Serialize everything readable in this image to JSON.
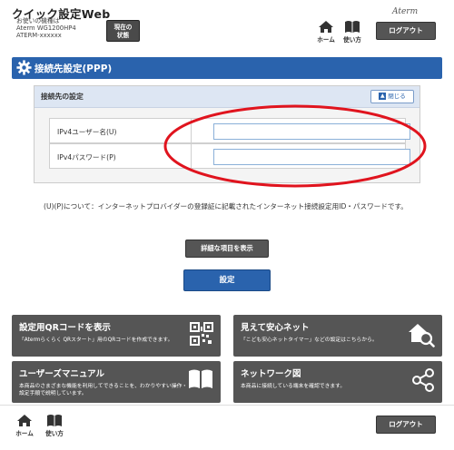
{
  "header": {
    "app_title": "クイック設定Web",
    "device_lines": [
      "お使いの機種は",
      "Aterm WG1200HP4",
      "ATERM-xxxxxx"
    ],
    "status_button": [
      "現在の",
      "状態"
    ],
    "brand": "Aterm",
    "home_label": "ホーム",
    "help_label": "使い方",
    "logout_label": "ログアウト"
  },
  "section": {
    "title": "接続先設定(PPP)"
  },
  "panel": {
    "heading": "接続先の設定",
    "close_label": "閉じる",
    "fields": [
      {
        "label": "IPv4ユーザー名(U)",
        "value": ""
      },
      {
        "label": "IPv4パスワード(P)",
        "value": ""
      }
    ]
  },
  "note": "(U)(P)について：インターネットプロバイダーの登録証に記載されたインターネット接続設定用ID・パスワードです。",
  "buttons": {
    "detail_label": "詳細な項目を表示",
    "apply_label": "設定"
  },
  "tiles": [
    {
      "title": "設定用QRコードを表示",
      "desc": "「Atermらくらく QRスタート」用のQRコードを作成できます。",
      "icon": "qr-code-icon"
    },
    {
      "title": "見えて安心ネット",
      "desc": "「こども安心ネットタイマー」などの設定はこちらから。",
      "icon": "home-search-icon"
    },
    {
      "title": "ユーザーズマニュアル",
      "desc": "本商品のさまざまな機能を利用してできることを、わかりやすい操作・設定手順で説明しています。",
      "icon": "book-icon"
    },
    {
      "title": "ネットワーク図",
      "desc": "本商品に接続している端末を確認できます。",
      "icon": "share-network-icon"
    }
  ],
  "footer": {
    "home_label": "ホーム",
    "help_label": "使い方",
    "logout_label": "ログアウト"
  },
  "colors": {
    "accent": "#2a63ad",
    "tile": "#555555",
    "highlight": "#e0141e"
  }
}
